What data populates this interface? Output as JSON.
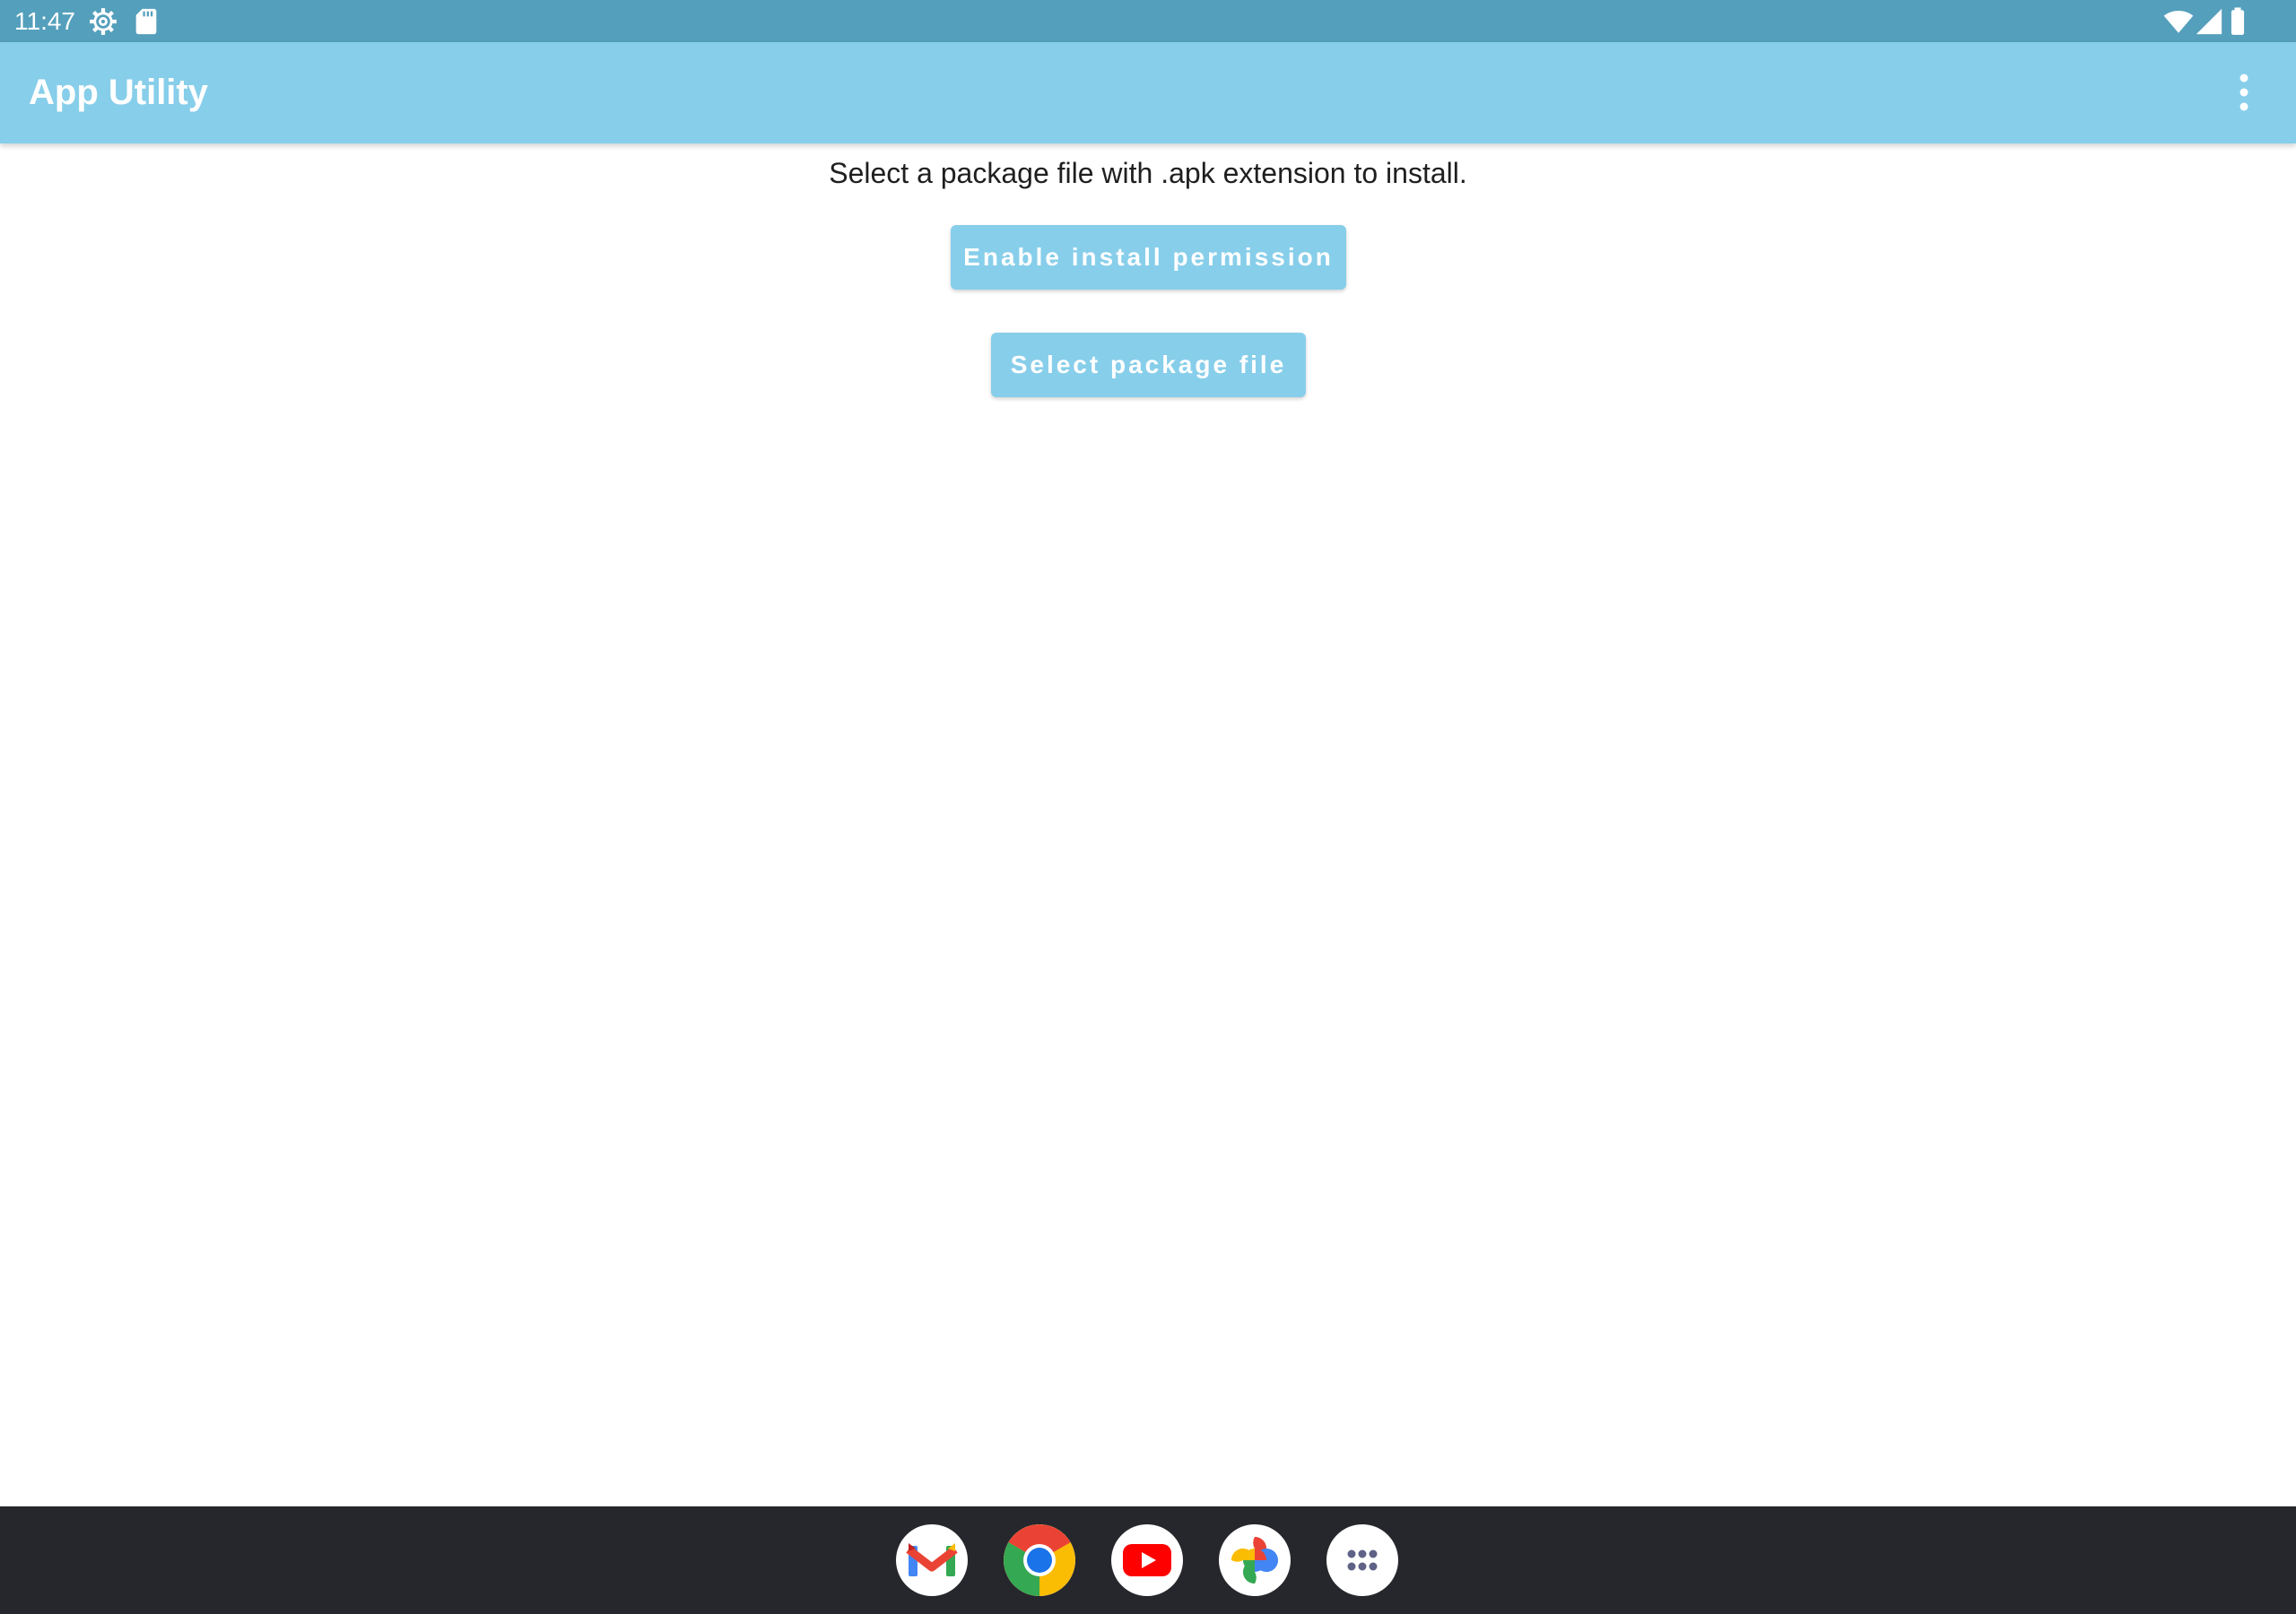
{
  "status_bar": {
    "time": "11:47",
    "icons": [
      "settings-gear-icon",
      "sd-card-icon",
      "wifi-icon",
      "cell-signal-icon",
      "battery-icon"
    ]
  },
  "app_bar": {
    "title": "App Utility",
    "menu_icon": "more-vert-icon",
    "background_color": "#87ceea"
  },
  "main": {
    "instruction": "Select a package file with .apk extension to install.",
    "enable_permission_label": "Enable install permission",
    "select_package_label": "Select package file",
    "button_color": "#87ceea"
  },
  "taskbar": {
    "apps": [
      "gmail-icon",
      "chrome-icon",
      "youtube-icon",
      "photos-icon",
      "app-drawer-icon"
    ],
    "background_color": "#26272c"
  }
}
